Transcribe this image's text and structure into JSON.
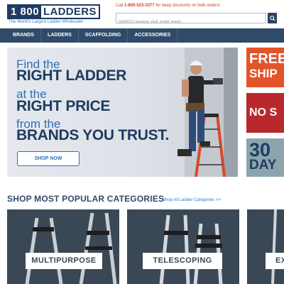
{
  "header": {
    "logo_number": "1 800",
    "logo_word": "LADDERS",
    "tagline": "The World's Largest Ladder Wholesaler",
    "promo_prefix": "Call ",
    "promo_phone": "1-800-523-3377",
    "promo_suffix": " for deep discounts on bulk orders!",
    "search_placeholder": "SEARCH: keyword, skull, model, brand"
  },
  "nav": {
    "items": [
      "BRANDS",
      "LADDERS",
      "SCAFFOLDING",
      "ACCESSORIES"
    ]
  },
  "hero": {
    "line1": "Find the",
    "line2": "RIGHT LADDER",
    "line3": "at the",
    "line4": "RIGHT PRICE",
    "line5": "from the",
    "line6": "BRANDS YOU TRUST.",
    "cta": "SHOP NOW"
  },
  "side_promos": {
    "free_a": "FREE",
    "free_b": "SHIP",
    "no": "NO S",
    "days_a": "30",
    "days_b": "DAY"
  },
  "categories": {
    "title": "SHOP MOST POPULAR CATEGORIES",
    "link": "Shop All Ladder Categories >>",
    "items": [
      "MULTIPURPOSE",
      "TELESCOPING",
      "EX"
    ]
  },
  "colors": {
    "navy": "#1f3b60",
    "nav_bg": "#2f4b69",
    "accent_blue": "#2f6fb3",
    "promo_red": "#d63a1e",
    "free_ship_orange": "#e2542a",
    "no_red": "#b8292d",
    "thirty_day_gray": "#8ba4ae"
  },
  "icons": {
    "search": "search-icon"
  }
}
